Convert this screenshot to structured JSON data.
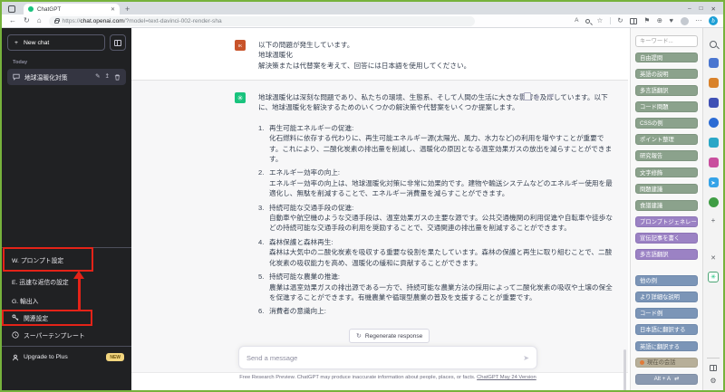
{
  "colors": {
    "accent_green": "#19c37d",
    "annotation_red": "#e42318",
    "button_green": "#8ba28c",
    "button_purple": "#9b82c4",
    "button_blue": "#7b95b7",
    "button_tan": "#b7af99",
    "button_shortcut": "#8a99b0",
    "badge_yellow": "#f2d57e",
    "screenshot_border": "#76b23c"
  },
  "glyphs": {
    "plus": "+",
    "back": "←",
    "refresh": "↻",
    "home": "⌂",
    "read_aloud": "A",
    "star": "☆",
    "sync": "↻",
    "flag": "⚑",
    "web_plus": "⊕",
    "heart": "♥",
    "person": "☻",
    "more": "…",
    "kebab": "⋯",
    "minimize": "–",
    "maximize": "□",
    "close": "✕",
    "pencil": "✎",
    "share": "↥",
    "trash": "▥",
    "openai": "✳",
    "send": "➤",
    "swap": "⇄",
    "gear": "⚙",
    "clock": "◴",
    "key": "⚷",
    "up": "+",
    "plane": "➤",
    "tree": "♣"
  },
  "browser": {
    "tab_title": "ChatGPT",
    "url_scheme": "https://",
    "url_host": "chat.openai.com",
    "url_path": "/?model=text-davinci-002-render-sha",
    "bing_label": "b"
  },
  "sidebar": {
    "new_chat_label": "New chat",
    "today_label": "Today",
    "chat_item": "地球温暖化対策",
    "menu": {
      "prompt_settings": "W. プロンプト設定",
      "quick_reply_settings": "E. 迅速な返信の設定",
      "import_export": "G. 輸出入",
      "related_settings": "関連設定",
      "super_template": "スーパーテンプレート",
      "upgrade": "Upgrade to Plus",
      "upgrade_badge": "NEW"
    }
  },
  "chat": {
    "user": {
      "avatar_text": "IK",
      "lines": [
        "以下の問題が発生しています。",
        "地球温暖化",
        "解決策または代替案を考えて、回答には日本語を使用してください。"
      ]
    },
    "assistant": {
      "intro": "地球温暖化は深刻な問題であり、私たちの環境、生態系、そして人間の生活に大きな影響を及ぼしています。以下に、地球温暖化を解決するためのいくつかの解決策や代替案をいくつか提案します。",
      "items": [
        {
          "title": "再生可能エネルギーの促進:",
          "body": "化石燃料に依存する代わりに、再生可能エネルギー源(太陽光、風力、水力など)の利用を増やすことが重要です。これにより、二酸化炭素の排出量を削減し、温暖化の原因となる温室効果ガスの放出を減らすことができます。"
        },
        {
          "title": "エネルギー効率の向上:",
          "body": "エネルギー効率の向上は、地球温暖化対策に非常に効果的です。建物や輸送システムなどのエネルギー使用を最適化し、無駄を削減することで、エネルギー消費量を減らすことができます。"
        },
        {
          "title": "持続可能な交通手段の促進:",
          "body": "自動車や航空機のような交通手段は、温室効果ガスの主要な源です。公共交通機関の利用促進や自転車や徒歩などの持続可能な交通手段の利用を奨励することで、交通関連の排出量を削減することができます。"
        },
        {
          "title": "森林保護と森林再生:",
          "body": "森林は大気中の二酸化炭素を吸収する重要な役割を果たしています。森林の保護と再生に取り組むことで、二酸化炭素の吸収能力を高め、温暖化の緩和に貢献することができます。"
        },
        {
          "title": "持続可能な農業の推進:",
          "body": "農業は温室効果ガスの排出源である一方で、持続可能な農業方法の採用によって二酸化炭素の吸収や土壌の保全を促進することができます。有機農業や循環型農業の普及を支援することが重要です。"
        },
        {
          "title": "消費者の意識向上:",
          "body": ""
        }
      ]
    },
    "regenerate_label": "Regenerate response",
    "input_placeholder": "Send a message",
    "footer_text": "Free Research Preview. ChatGPT may produce inaccurate information about people, places, or facts.",
    "footer_link": "ChatGPT May 24 Version"
  },
  "extension_panel": {
    "keyword_placeholder": "キーワード...",
    "green_buttons": [
      "自由提問",
      "英語の説明",
      "多言語翻訳",
      "コード問題",
      "CSSの例",
      "ポイント整理",
      "研究報告",
      "文字修飾",
      "問題建議",
      "食譜建議"
    ],
    "purple_buttons": [
      "プロンプトジェネレーター",
      "宣伝記事を書く",
      "多言語翻訳"
    ],
    "blue_buttons": [
      "他の例",
      "より詳細な説明",
      "コード例",
      "日本語に翻訳する",
      "英語に翻訳する"
    ],
    "conversation_button": "現在の会話",
    "shortcut_label": "Alt + A"
  }
}
